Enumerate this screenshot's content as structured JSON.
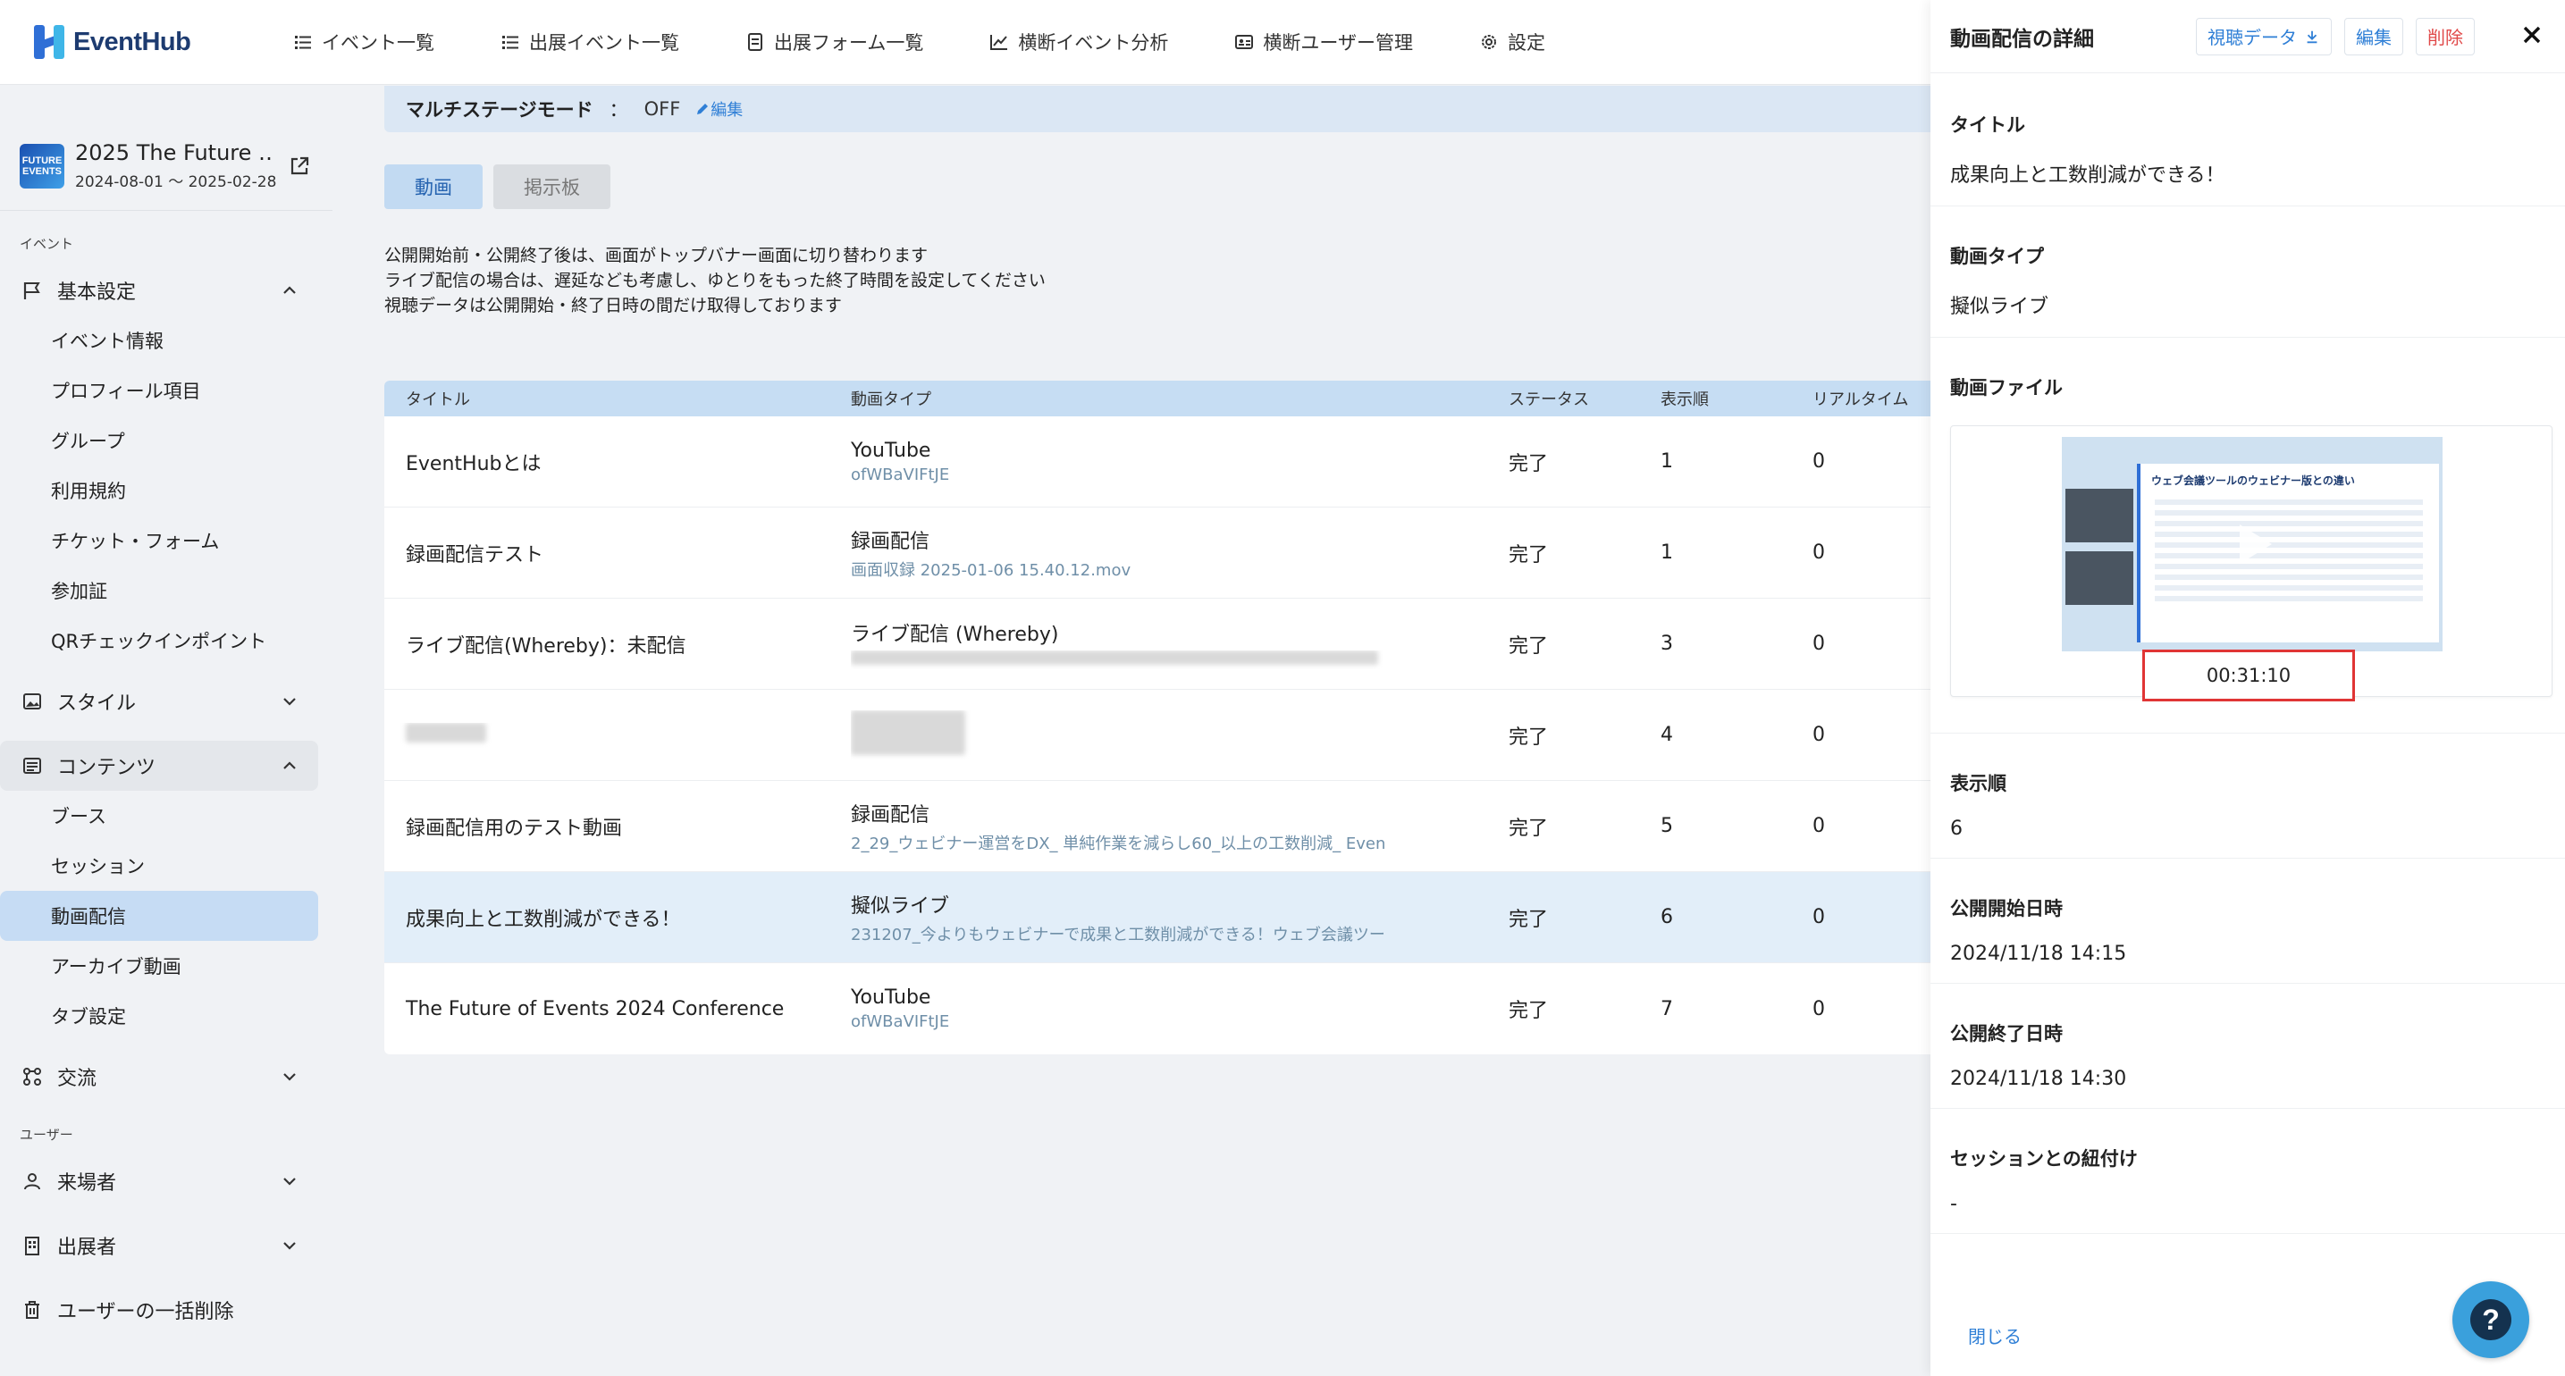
{
  "app": {
    "logo_text": "EventHub"
  },
  "nav": [
    {
      "label": "イベント一覧",
      "icon": "list-icon"
    },
    {
      "label": "出展イベント一覧",
      "icon": "list-icon"
    },
    {
      "label": "出展フォーム一覧",
      "icon": "document-icon"
    },
    {
      "label": "横断イベント分析",
      "icon": "chart-icon"
    },
    {
      "label": "横断ユーザー管理",
      "icon": "id-card-icon"
    },
    {
      "label": "設定",
      "icon": "gear-icon"
    }
  ],
  "event": {
    "thumb_text": "FUTURE EVENTS",
    "title": "2025 The Future …",
    "dates": "2024-08-01 ～ 2025-02-28"
  },
  "sidebar": {
    "section_event": "イベント",
    "basic": {
      "label": "基本設定",
      "items": [
        "イベント情報",
        "プロフィール項目",
        "グループ",
        "利用規約",
        "チケット・フォーム",
        "参加証",
        "QRチェックインポイント"
      ]
    },
    "style": {
      "label": "スタイル"
    },
    "contents": {
      "label": "コンテンツ",
      "items": [
        "ブース",
        "セッション",
        "動画配信",
        "アーカイブ動画",
        "タブ設定"
      ]
    },
    "exchange": {
      "label": "交流"
    },
    "section_user": "ユーザー",
    "visitors": {
      "label": "来場者"
    },
    "exhibitors": {
      "label": "出展者"
    },
    "bulk_delete": {
      "label": "ユーザーの一括削除"
    }
  },
  "main": {
    "mode_label": "マルチステージモード",
    "mode_colon": "：",
    "mode_value": "OFF",
    "mode_edit": "編集",
    "tabs": [
      "動画",
      "掲示板"
    ],
    "notes": [
      "公開開始前・公開終了後は、画面がトップバナー画面に切り替わります",
      "ライブ配信の場合は、遅延なども考慮し、ゆとりをもった終了時間を設定してください",
      "視聴データは公開開始・終了日時の間だけ取得しております"
    ],
    "columns": [
      "タイトル",
      "動画タイプ",
      "ステータス",
      "表示順",
      "リアルタイム"
    ],
    "rows": [
      {
        "title": "EventHubとは",
        "type": "YouTube",
        "sub": "ofWBaVIFtJE",
        "status": "完了",
        "order": "1",
        "rt": "0"
      },
      {
        "title": "録画配信テスト",
        "type": "録画配信",
        "sub": "画面収録 2025-01-06 15.40.12.mov",
        "status": "完了",
        "order": "1",
        "rt": "0"
      },
      {
        "title": "ライブ配信(Whereby)：未配信",
        "type": "ライブ配信 (Whereby)",
        "sub": "",
        "status": "完了",
        "order": "3",
        "rt": "0"
      },
      {
        "title": "",
        "type": "",
        "sub": "",
        "status": "完了",
        "order": "4",
        "rt": "0"
      },
      {
        "title": "録画配信用のテスト動画",
        "type": "録画配信",
        "sub": "2_29_ウェビナー運営をDX_ 単純作業を減らし60_以上の工数削減_ Even",
        "status": "完了",
        "order": "5",
        "rt": "0"
      },
      {
        "title": "成果向上と工数削減ができる！",
        "type": "擬似ライブ",
        "sub": "231207_今よりもウェビナーで成果と工数削減ができる！ウェブ会議ツー",
        "status": "完了",
        "order": "6",
        "rt": "0"
      },
      {
        "title": "The Future of Events 2024 Conference",
        "type": "YouTube",
        "sub": "ofWBaVIFtJE",
        "status": "完了",
        "order": "7",
        "rt": "0"
      }
    ]
  },
  "panel": {
    "title": "動画配信の詳細",
    "view_data": "視聴データ",
    "edit": "編集",
    "delete": "削除",
    "fields": {
      "title_label": "タイトル",
      "title_value": "成果向上と工数削減ができる！",
      "type_label": "動画タイプ",
      "type_value": "擬似ライブ",
      "file_label": "動画ファイル",
      "thumb_slide_title": "ウェブ会議ツールのウェビナー版との違い",
      "duration": "00:31:10",
      "order_label": "表示順",
      "order_value": "6",
      "start_label": "公開開始日時",
      "start_value": "2024/11/18 14:15",
      "end_label": "公開終了日時",
      "end_value": "2024/11/18 14:30",
      "session_label": "セッションとの紐付け",
      "session_value": "-"
    },
    "close": "閉じる"
  },
  "help": {
    "label": "?"
  },
  "colors": {
    "accent": "#2f7fd6",
    "selected": "#c6dcf4",
    "danger": "#e04848",
    "highlight": "#e03535"
  }
}
